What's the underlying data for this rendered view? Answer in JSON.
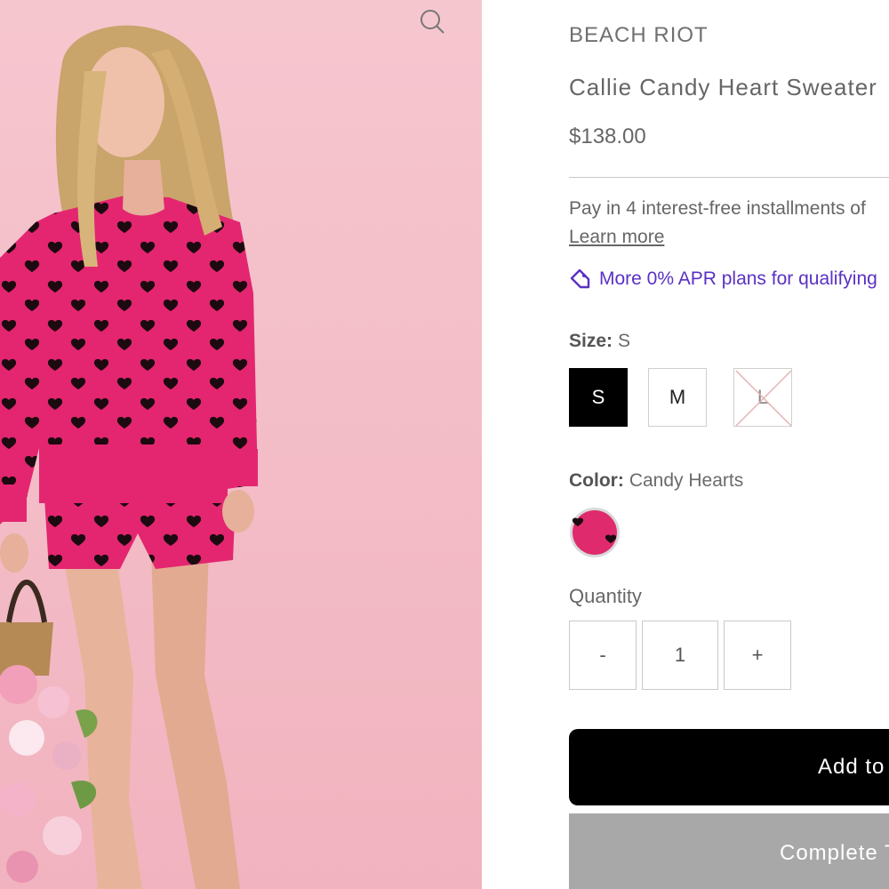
{
  "product": {
    "brand": "BEACH RIOT",
    "title": "Callie Candy Heart Sweater",
    "price": "$138.00"
  },
  "payment": {
    "installments_text": "Pay in 4 interest-free installments of",
    "learn_more": "Learn more",
    "apr_text": "More 0% APR plans for qualifying",
    "apr_color": "#5a31c4"
  },
  "size": {
    "label": "Size:",
    "selected": "S",
    "options": [
      {
        "label": "S",
        "state": "selected"
      },
      {
        "label": "M",
        "state": "available"
      },
      {
        "label": "L",
        "state": "unavailable"
      }
    ]
  },
  "color": {
    "label": "Color:",
    "selected": "Candy Hearts",
    "swatch_color": "#e02a6e"
  },
  "quantity": {
    "label": "Quantity",
    "decrement": "-",
    "value": "1",
    "increment": "+"
  },
  "buttons": {
    "add_to_cart": "Add to Cart",
    "complete": "Complete The Look"
  },
  "icons": {
    "zoom": "magnifier-icon",
    "apr": "tag-icon"
  }
}
